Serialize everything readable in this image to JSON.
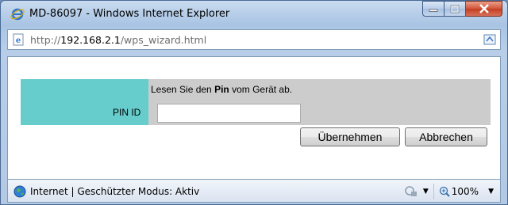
{
  "window": {
    "title": "MD-86097 - Windows Internet Explorer",
    "minimize_label": "minimize",
    "maximize_label": "maximize",
    "close_label": "close"
  },
  "addressbar": {
    "url_prefix": "http://",
    "url_host": "192.168.2.1",
    "url_path": "/wps_wizard.html"
  },
  "page": {
    "message_pre": "Lesen Sie den ",
    "message_bold": "Pin",
    "message_post": " vom Gerät ab.",
    "pin_label": "PIN ID",
    "pin_value": "",
    "apply_button": "Übernehmen",
    "cancel_button": "Abbrechen"
  },
  "statusbar": {
    "zone_text": "Internet | Geschützter Modus: Aktiv",
    "zoom": "100%"
  },
  "colors": {
    "teal_cell": "#66cccc",
    "gray_cell": "#cccccc"
  }
}
